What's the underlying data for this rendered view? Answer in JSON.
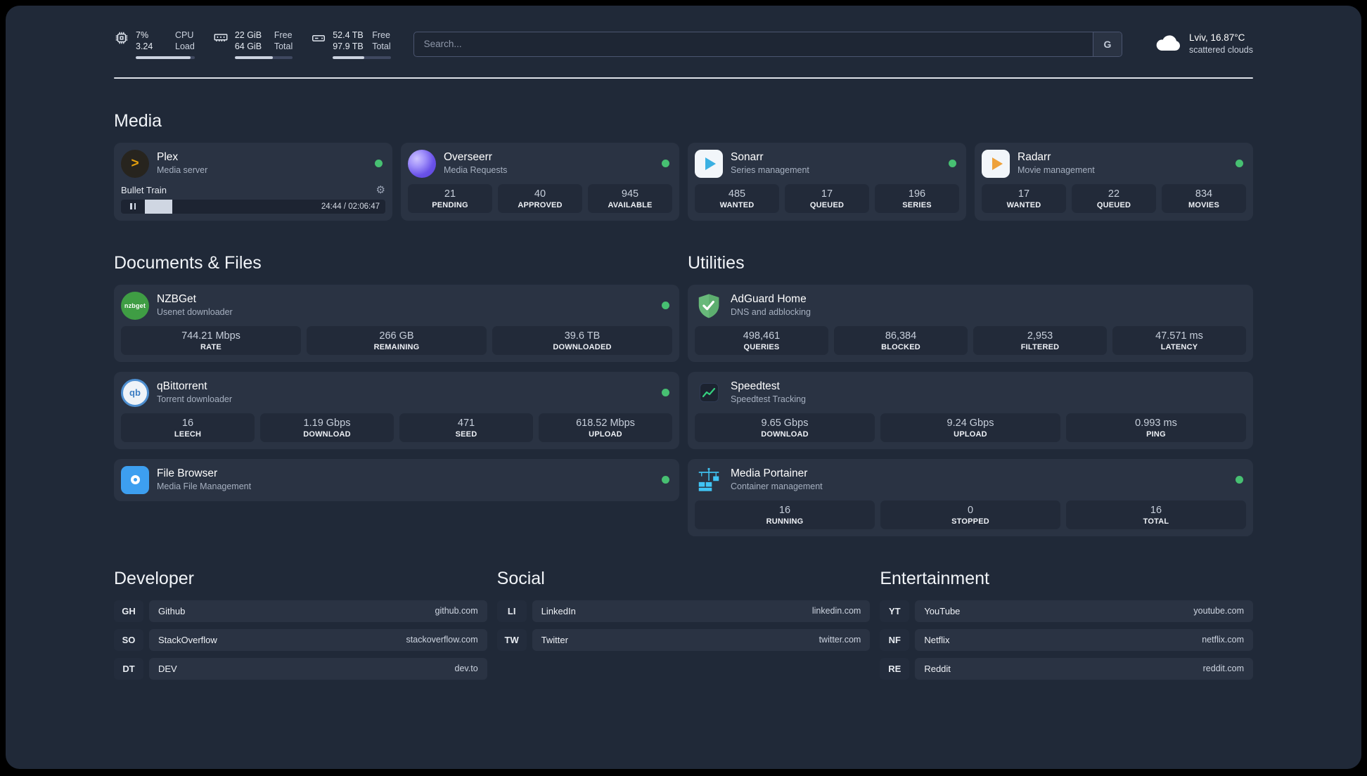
{
  "topbar": {
    "cpu": {
      "value": "7%",
      "sub": "3.24",
      "label_top": "CPU",
      "label_bottom": "Load",
      "bar_percent": 93
    },
    "ram": {
      "value": "22 GiB",
      "sub": "64 GiB",
      "label_top": "Free",
      "label_bottom": "Total",
      "bar_percent": 66
    },
    "disk": {
      "value": "52.4 TB",
      "sub": "97.9 TB",
      "label_top": "Free",
      "label_bottom": "Total",
      "bar_percent": 54
    },
    "search": {
      "placeholder": "Search...",
      "button_label": "G"
    },
    "weather": {
      "location": "Lviv, 16.87°C",
      "condition": "scattered clouds"
    }
  },
  "sections": {
    "media": "Media",
    "documents": "Documents & Files",
    "utilities": "Utilities",
    "developer": "Developer",
    "social": "Social",
    "entertainment": "Entertainment"
  },
  "apps": {
    "plex": {
      "name": "Plex",
      "desc": "Media server",
      "now_playing": "Bullet Train",
      "time": "24:44 / 02:06:47",
      "progress_percent": 16
    },
    "overseerr": {
      "name": "Overseerr",
      "desc": "Media Requests",
      "stats": [
        {
          "value": "21",
          "label": "PENDING"
        },
        {
          "value": "40",
          "label": "APPROVED"
        },
        {
          "value": "945",
          "label": "AVAILABLE"
        }
      ]
    },
    "sonarr": {
      "name": "Sonarr",
      "desc": "Series management",
      "stats": [
        {
          "value": "485",
          "label": "WANTED"
        },
        {
          "value": "17",
          "label": "QUEUED"
        },
        {
          "value": "196",
          "label": "SERIES"
        }
      ]
    },
    "radarr": {
      "name": "Radarr",
      "desc": "Movie management",
      "stats": [
        {
          "value": "17",
          "label": "WANTED"
        },
        {
          "value": "22",
          "label": "QUEUED"
        },
        {
          "value": "834",
          "label": "MOVIES"
        }
      ]
    },
    "nzbget": {
      "name": "NZBGet",
      "desc": "Usenet downloader",
      "stats": [
        {
          "value": "744.21 Mbps",
          "label": "RATE"
        },
        {
          "value": "266 GB",
          "label": "REMAINING"
        },
        {
          "value": "39.6 TB",
          "label": "DOWNLOADED"
        }
      ]
    },
    "qbittorrent": {
      "name": "qBittorrent",
      "desc": "Torrent downloader",
      "stats": [
        {
          "value": "16",
          "label": "LEECH"
        },
        {
          "value": "1.19 Gbps",
          "label": "DOWNLOAD"
        },
        {
          "value": "471",
          "label": "SEED"
        },
        {
          "value": "618.52 Mbps",
          "label": "UPLOAD"
        }
      ]
    },
    "filebrowser": {
      "name": "File Browser",
      "desc": "Media File Management"
    },
    "adguard": {
      "name": "AdGuard Home",
      "desc": "DNS and adblocking",
      "stats": [
        {
          "value": "498,461",
          "label": "QUERIES"
        },
        {
          "value": "86,384",
          "label": "BLOCKED"
        },
        {
          "value": "2,953",
          "label": "FILTERED"
        },
        {
          "value": "47.571 ms",
          "label": "LATENCY"
        }
      ]
    },
    "speedtest": {
      "name": "Speedtest",
      "desc": "Speedtest Tracking",
      "stats": [
        {
          "value": "9.65 Gbps",
          "label": "DOWNLOAD"
        },
        {
          "value": "9.24 Gbps",
          "label": "UPLOAD"
        },
        {
          "value": "0.993 ms",
          "label": "PING"
        }
      ]
    },
    "portainer": {
      "name": "Media Portainer",
      "desc": "Container management",
      "stats": [
        {
          "value": "16",
          "label": "RUNNING"
        },
        {
          "value": "0",
          "label": "STOPPED"
        },
        {
          "value": "16",
          "label": "TOTAL"
        }
      ]
    }
  },
  "bookmarks": {
    "developer": [
      {
        "abbr": "GH",
        "name": "Github",
        "url": "github.com"
      },
      {
        "abbr": "SO",
        "name": "StackOverflow",
        "url": "stackoverflow.com"
      },
      {
        "abbr": "DT",
        "name": "DEV",
        "url": "dev.to"
      }
    ],
    "social": [
      {
        "abbr": "LI",
        "name": "LinkedIn",
        "url": "linkedin.com"
      },
      {
        "abbr": "TW",
        "name": "Twitter",
        "url": "twitter.com"
      }
    ],
    "entertainment": [
      {
        "abbr": "YT",
        "name": "YouTube",
        "url": "youtube.com"
      },
      {
        "abbr": "NF",
        "name": "Netflix",
        "url": "netflix.com"
      },
      {
        "abbr": "RE",
        "name": "Reddit",
        "url": "reddit.com"
      }
    ]
  },
  "glyphs": {
    "gear": "⚙",
    "plex_chevron": ">",
    "qbittorrent": "qb",
    "nzbget": "nzbget"
  },
  "colors": {
    "accent_green": "#47c072",
    "background": "#202938",
    "card": "#2a3343",
    "tile": "#222a39"
  }
}
